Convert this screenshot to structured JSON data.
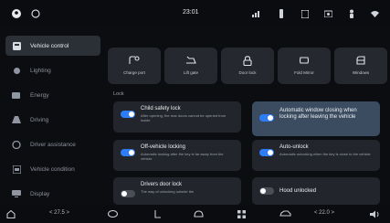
{
  "statusbar": {
    "time": "23:01",
    "icons": [
      "profile-icon",
      "shield-icon",
      "signal-icon",
      "usb-icon",
      "bluetooth-icon",
      "camera-icon",
      "person-icon",
      "wifi-icon"
    ]
  },
  "sidebar": {
    "items": [
      {
        "label": "Vehicle control",
        "icon": "car-icon",
        "active": true
      },
      {
        "label": "Lighting",
        "icon": "light-icon",
        "active": false
      },
      {
        "label": "Energy",
        "icon": "battery-icon",
        "active": false
      },
      {
        "label": "Driving",
        "icon": "steering-icon",
        "active": false
      },
      {
        "label": "Driver assistance",
        "icon": "assist-icon",
        "active": false
      },
      {
        "label": "Vehicle condition",
        "icon": "condition-icon",
        "active": false
      },
      {
        "label": "Display",
        "icon": "display-icon",
        "active": false
      }
    ]
  },
  "quick_controls": [
    {
      "label": "Charge port",
      "icon": "charge-port-icon"
    },
    {
      "label": "Lift gate",
      "icon": "lift-gate-icon"
    },
    {
      "label": "Door lock",
      "icon": "lock-icon"
    },
    {
      "label": "Fold Mirror",
      "icon": "mirror-icon"
    },
    {
      "label": "Windows",
      "icon": "window-icon"
    }
  ],
  "section_lock": "Lock",
  "lock_settings": [
    {
      "title": "Child safety lock",
      "desc": "After opening, the rear doors cannot be opened from inside",
      "on": true,
      "highlight": false
    },
    {
      "title": "Automatic window closing when locking after leaving the vehicle",
      "desc": "",
      "on": true,
      "highlight": true
    },
    {
      "title": "Off-vehicle locking",
      "desc": "Automatic locking after the key is far away from the vehicle",
      "on": true,
      "highlight": false
    },
    {
      "title": "Auto-unlock",
      "desc": "Automatic unlocking when the key is close to the vehicle",
      "on": true,
      "highlight": false
    },
    {
      "title": "Drivers door lock",
      "desc": "The way of unlocking outside the",
      "on": false,
      "highlight": false
    },
    {
      "title": "Hood unlocked",
      "desc": "",
      "on": false,
      "highlight": false
    }
  ],
  "bottombar": {
    "temp_left": "< 27.5 >",
    "temp_right": "< 22.0 >",
    "icons": [
      "home-icon",
      "seat-heat-left-icon",
      "fan-icon",
      "defrost-icon",
      "apps-icon",
      "car-climate-icon",
      "volume-icon"
    ]
  },
  "colors": {
    "accent": "#2e7cf6",
    "highlight_card": "#3b4c61",
    "card": "#22252b",
    "background": "#0c0d10"
  }
}
